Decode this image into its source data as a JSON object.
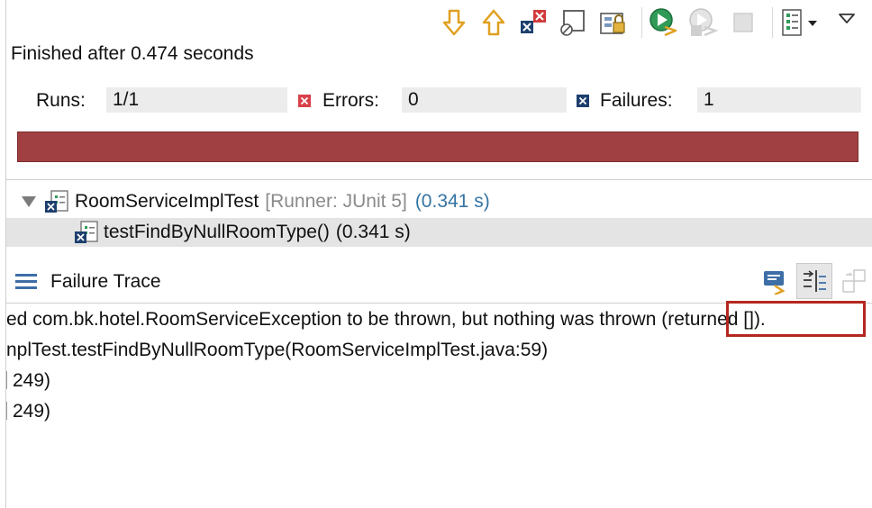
{
  "toolbar": {
    "buttons": [
      {
        "name": "next-failure",
        "icon": "arrow-down-icon"
      },
      {
        "name": "previous-failure",
        "icon": "arrow-up-icon"
      },
      {
        "name": "show-failures-only",
        "icon": "failures-filter-icon"
      },
      {
        "name": "show-skipped-only",
        "icon": "skipped-filter-icon"
      },
      {
        "name": "scroll-lock",
        "icon": "scroll-lock-icon"
      },
      {
        "name": "rerun-test",
        "icon": "rerun-icon"
      },
      {
        "name": "rerun-failures-first",
        "icon": "rerun-failed-icon"
      },
      {
        "name": "stop",
        "icon": "stop-icon"
      },
      {
        "name": "test-run-history",
        "icon": "history-icon"
      }
    ]
  },
  "status": {
    "text": "Finished after 0.474 seconds"
  },
  "counters": {
    "runs_label": "Runs:",
    "runs_value": "1/1",
    "errors_label": "Errors:",
    "errors_value": "0",
    "failures_label": "Failures:",
    "failures_value": "1"
  },
  "progress": {
    "color": "#a04043",
    "fraction": 1.0
  },
  "tree": {
    "suite": {
      "name": "RoomServiceImplTest",
      "runner": "[Runner: JUnit 5]",
      "time": "(0.341 s)"
    },
    "test": {
      "name": "testFindByNullRoomType()",
      "time": "(0.341 s)"
    }
  },
  "failure_trace": {
    "title": "Failure Trace",
    "lines": [
      "ed com.bk.hotel.RoomServiceException to be thrown, but nothing was thrown (returned []).",
      "nplTest.testFindByNullRoomType(RoomServiceImplTest.java:59)",
      "249)",
      "249)"
    ]
  },
  "colors": {
    "failure": "#a04043",
    "link_blue": "#3474a4",
    "highlight": "#b52720"
  }
}
